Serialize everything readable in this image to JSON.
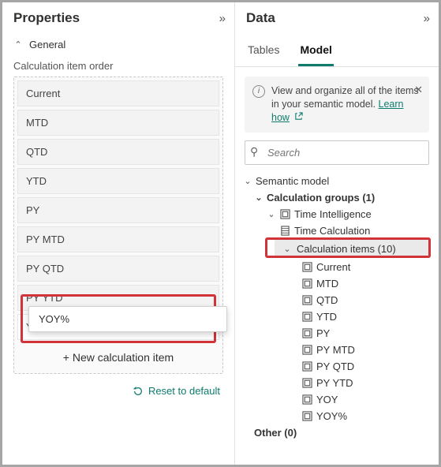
{
  "properties": {
    "title": "Properties",
    "section_general": "General",
    "subhead": "Calculation item order",
    "items": [
      "Current",
      "MTD",
      "QTD",
      "YTD",
      "PY",
      "PY MTD",
      "PY QTD",
      "PY YTD",
      "YOY"
    ],
    "dragging_item": "YOY%",
    "new_item_label": "+ New calculation item",
    "reset_label": "Reset to default"
  },
  "data_panel": {
    "title": "Data",
    "tabs": {
      "tables": "Tables",
      "model": "Model"
    },
    "info_text": "View and organize all of the items in your semantic model.",
    "info_link": "Learn how",
    "search_placeholder": "Search",
    "tree": {
      "root": "Semantic model",
      "calc_groups": "Calculation groups (1)",
      "time_intel": "Time Intelligence",
      "time_calc": "Time Calculation",
      "calc_items": "Calculation items (10)",
      "items": [
        "Current",
        "MTD",
        "QTD",
        "YTD",
        "PY",
        "PY MTD",
        "PY QTD",
        "PY YTD",
        "YOY",
        "YOY%"
      ],
      "other": "Other (0)"
    }
  }
}
